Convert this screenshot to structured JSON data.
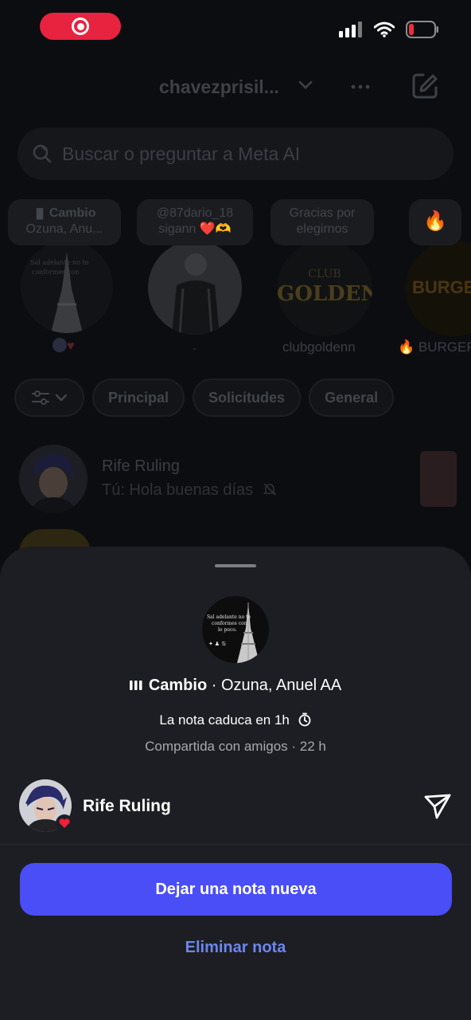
{
  "status_bar": {
    "record_indicator": "screen-recording",
    "icons": [
      "signal-icon",
      "wifi-icon",
      "battery-icon"
    ]
  },
  "header": {
    "account_name": "chavezprisil..."
  },
  "search": {
    "placeholder": "Buscar o preguntar a Meta AI"
  },
  "notes": [
    {
      "line1": "Cambio",
      "line2": "Ozuna, Anu...",
      "name": ""
    },
    {
      "line1": "@87dario_18",
      "line2": "sigann ❤️🫶",
      "name": "."
    },
    {
      "line1": "Gracias por",
      "line2": "elegirnos",
      "name": "clubgoldenn",
      "logo_line1": "CLUB",
      "logo_line2": "GOLDEN"
    },
    {
      "line1": "🔥",
      "line2": "",
      "name": "🔥 BURGER"
    }
  ],
  "filters": {
    "tabs": [
      "Principal",
      "Solicitudes",
      "General"
    ]
  },
  "chats": [
    {
      "name": "Rife Ruling",
      "message": "Tú: Hola buenas días"
    }
  ],
  "sheet": {
    "song_title": "Cambio",
    "song_artist": "· Ozuna, Anuel AA",
    "expires": "La nota caduca en 1h",
    "shared": "Compartida con amigos · 22 h",
    "owner_name": "Rife Ruling",
    "primary_action": "Dejar una nota nueva",
    "secondary_action": "Eliminar nota"
  },
  "colors": {
    "accent_button": "#4a4ef7",
    "link": "#6c86ef",
    "sheet_bg": "#1d1e23",
    "record_pill": "#e8233f"
  }
}
